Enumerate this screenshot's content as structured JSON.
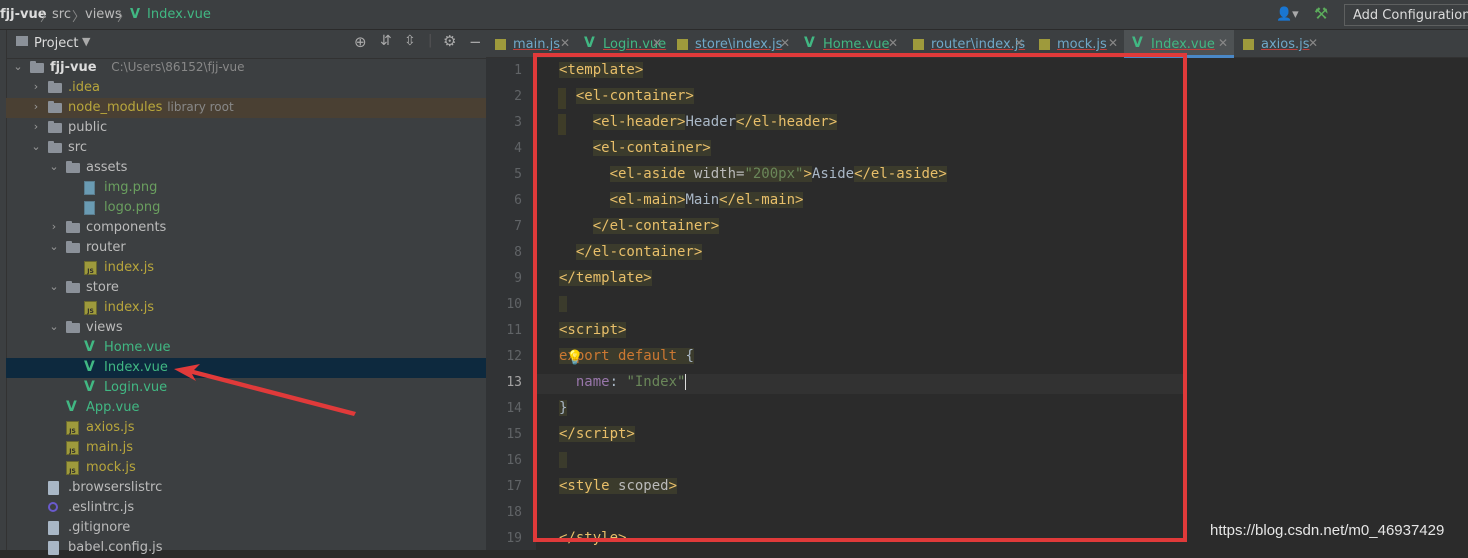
{
  "breadcrumb": {
    "project": "fjj-vue",
    "src": "src",
    "views": "views",
    "file": "Index.vue"
  },
  "toolbar": {
    "add_config": "Add Configuration..."
  },
  "project_panel": {
    "title": "Project",
    "tree": [
      {
        "label": "fjj-vue",
        "hint": "C:\\Users\\86152\\fjj-vue",
        "type": "folder",
        "depth": 0,
        "expanded": true
      },
      {
        "label": ".idea",
        "type": "folder",
        "depth": 1,
        "expanded": false
      },
      {
        "label": "node_modules",
        "hint": "library root",
        "type": "folder",
        "depth": 1,
        "expanded": false
      },
      {
        "label": "public",
        "type": "folder",
        "depth": 1,
        "expanded": false
      },
      {
        "label": "src",
        "type": "folder",
        "depth": 1,
        "expanded": true
      },
      {
        "label": "assets",
        "type": "folder",
        "depth": 2,
        "expanded": true
      },
      {
        "label": "img.png",
        "type": "png",
        "depth": 3
      },
      {
        "label": "logo.png",
        "type": "png",
        "depth": 3
      },
      {
        "label": "components",
        "type": "folder",
        "depth": 2,
        "expanded": false
      },
      {
        "label": "router",
        "type": "folder",
        "depth": 2,
        "expanded": true
      },
      {
        "label": "index.js",
        "type": "js",
        "depth": 3
      },
      {
        "label": "store",
        "type": "folder",
        "depth": 2,
        "expanded": true
      },
      {
        "label": "index.js",
        "type": "js",
        "depth": 3
      },
      {
        "label": "views",
        "type": "folder",
        "depth": 2,
        "expanded": true
      },
      {
        "label": "Home.vue",
        "type": "vue",
        "depth": 3
      },
      {
        "label": "Index.vue",
        "type": "vue",
        "depth": 3,
        "selected": true
      },
      {
        "label": "Login.vue",
        "type": "vue",
        "depth": 3
      },
      {
        "label": "App.vue",
        "type": "vue",
        "depth": 2
      },
      {
        "label": "axios.js",
        "type": "js",
        "depth": 2
      },
      {
        "label": "main.js",
        "type": "js",
        "depth": 2
      },
      {
        "label": "mock.js",
        "type": "js",
        "depth": 2
      },
      {
        "label": ".browserslistrc",
        "type": "file",
        "depth": 1
      },
      {
        "label": ".eslintrc.js",
        "type": "eslint",
        "depth": 1
      },
      {
        "label": ".gitignore",
        "type": "file",
        "depth": 1
      },
      {
        "label": "babel.config.js",
        "type": "file",
        "depth": 1
      }
    ]
  },
  "tabs": [
    {
      "label": "main.js",
      "type": "js"
    },
    {
      "label": "Login.vue",
      "type": "vue"
    },
    {
      "label": "store\\index.js",
      "type": "js"
    },
    {
      "label": "Home.vue",
      "type": "vue"
    },
    {
      "label": "router\\index.js",
      "type": "js"
    },
    {
      "label": "mock.js",
      "type": "js"
    },
    {
      "label": "Index.vue",
      "type": "vue",
      "active": true
    },
    {
      "label": "axios.js",
      "type": "js"
    }
  ],
  "editor": {
    "line_numbers": [
      "1",
      "2",
      "3",
      "4",
      "5",
      "6",
      "7",
      "8",
      "9",
      "10",
      "11",
      "12",
      "13",
      "14",
      "15",
      "16",
      "17",
      "18",
      "19"
    ],
    "current_line": "13"
  },
  "watermark": "https://blog.csdn.net/m0_46937429",
  "colors": {
    "accent_red": "#e03a3a",
    "vue_green": "#41b883",
    "tag": "#e8bf6a",
    "string": "#6a8759"
  }
}
